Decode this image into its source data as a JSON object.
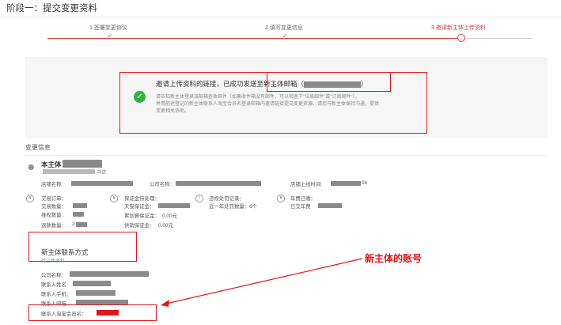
{
  "page_title": "阶段一：提交变更资料",
  "steps": [
    {
      "label": "1.签署变更协议"
    },
    {
      "label": "2.填写变更信息"
    },
    {
      "label": "3.邀请新主体上传资料"
    }
  ],
  "notice": {
    "main_prefix": "邀请上传资料的链接，已成功发送至新主体邮箱（",
    "main_suffix": "）",
    "line1": "请告知新主体登录该邮箱查收邮件（如果收件箱没有邮件，可以检查下\"垃圾邮件\"或\"订阅邮件\"），",
    "line2": "并用前述登记的新主体联系人淘宝会员名登录邮箱内邀请链接提交变更资源。请您与新主体保持沟通，提供",
    "line3": "变更相关协助。"
  },
  "section_title": "变更信息",
  "subject": {
    "name_prefix": "本主体",
    "status": "申请"
  },
  "store": {
    "name_label": "店铺名称:",
    "company_label": "公司名称:",
    "online_label": "店铺上线时间:",
    "online_suffix": "08"
  },
  "stats": {
    "trade": {
      "title": "交易订单：",
      "count_label": "交易数量：",
      "refund_label": "维权数量：",
      "return_label": "退款数量：",
      "return_value": "2"
    },
    "deposit": {
      "title": "保证金待处理：",
      "tmall_label": "天猫保证金：",
      "accum_label": "累划算保证金：",
      "accum_value": "0.00元",
      "supply_label": "供销保证金：",
      "supply_value": "0.00元"
    },
    "violation": {
      "title": "违规处罚记录：",
      "line": "近一年处罚数量：6个"
    },
    "annual_fee": {
      "title": "年费已缴：",
      "label": "已交年费"
    }
  },
  "contact": {
    "title": "新主体联系方式",
    "subtitle": "待上传资料",
    "company_label": "公司名称：",
    "name_label": "联系人姓名",
    "phone_label": "联系人手机：",
    "email_label": "联系人邮箱",
    "member_label": "联系人淘宝会员名："
  },
  "annotation": "新主体的账号",
  "colors": {
    "accent_red": "#e03a3a",
    "highlight_red": "#e0161c",
    "success_green": "#2fb344",
    "panel_bg": "#f6f6f6"
  }
}
